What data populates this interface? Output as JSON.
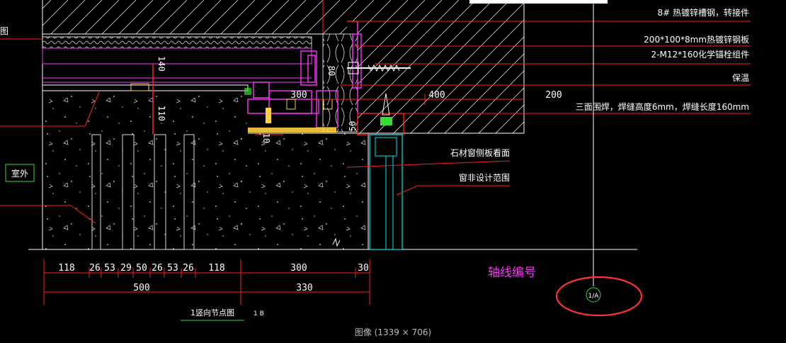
{
  "callouts": {
    "channel_steel": "8# 热镀锌槽钢，转接件",
    "steel_plate": "200*100*8mm热镀锌钢板",
    "anchor_bolt": "2-M12*160化学锚栓组件",
    "insulation": "保温",
    "weld": "三面围焊，焊缝高度6mm，焊缝长度160mm",
    "stone_face": "石材窗侧板看面",
    "window_scope": "窗非设计范围"
  },
  "labels": {
    "left_edge": "图",
    "outdoor": "室外",
    "axis_number": "轴线编号",
    "axis_bubble": "1/A",
    "detail_title": "1竖向节点图",
    "detail_sub": "1 B"
  },
  "dimensions": {
    "v140": "140",
    "v110": "110",
    "v80": "80",
    "v10": "10",
    "v50": "50",
    "h300": "300",
    "h400": "400",
    "h200": "200",
    "row1": [
      "118",
      "26",
      "53",
      "29",
      "50",
      "26",
      "53",
      "26",
      "118",
      "300",
      "30"
    ],
    "row2": [
      "500",
      "330"
    ]
  },
  "caption": "图像 (1339 × 706)",
  "colors": {
    "background": "#000000",
    "line": "#ffffff",
    "magenta": "#ff33ff",
    "red": "#ff2020",
    "cyan": "#00e5e5",
    "green": "#33dd33",
    "yellow": "#ffd040"
  }
}
